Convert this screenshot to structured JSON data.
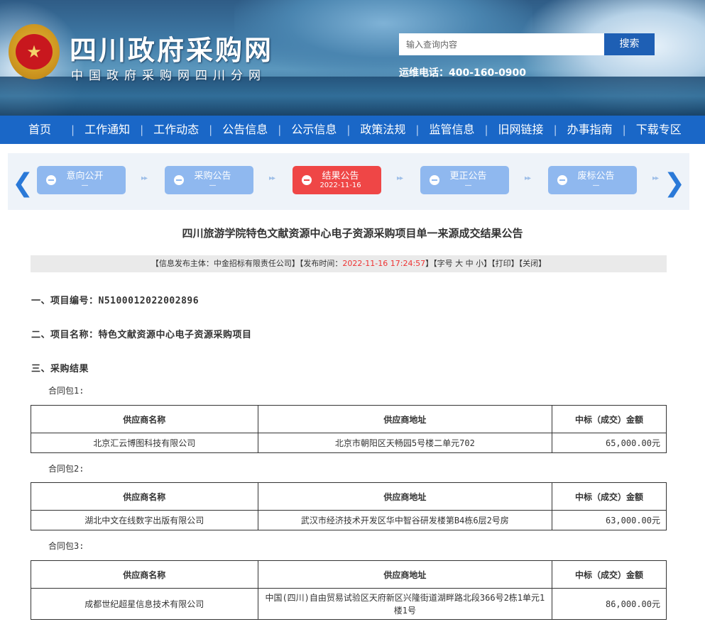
{
  "header": {
    "site_title": "四川政府采购网",
    "site_subtitle": "中国政府采购网四川分网",
    "search_placeholder": "输入查询内容",
    "search_button": "搜索",
    "hotline": "运维电话：400-160-0900"
  },
  "nav": {
    "items": [
      "首页",
      "工作通知",
      "工作动态",
      "公告信息",
      "公示信息",
      "政策法规",
      "监管信息",
      "旧网链接",
      "办事指南",
      "下载专区"
    ],
    "separator": "|"
  },
  "process": {
    "steps": [
      {
        "name": "意向公开",
        "date": "—",
        "active": false
      },
      {
        "name": "采购公告",
        "date": "—",
        "active": false
      },
      {
        "name": "结果公告",
        "date": "2022-11-16",
        "active": true
      },
      {
        "name": "更正公告",
        "date": "—",
        "active": false
      },
      {
        "name": "废标公告",
        "date": "—",
        "active": false
      }
    ],
    "connector": "▸▸",
    "prev_arrow": "❮",
    "next_arrow": "❯"
  },
  "article": {
    "title": "四川旅游学院特色文献资源中心电子资源采购项目单一来源成交结果公告",
    "meta": {
      "publisher_prefix": "【信息发布主体：中金招标有限责任公司】【发布时间：",
      "publish_time": "2022-11-16 17:24:57",
      "font_size_part": "】【字号 大 中 小】",
      "print": "【打印】",
      "close": "【关闭】"
    },
    "section1": "一、项目编号：N5100012022002896",
    "section2": "二、项目名称：特色文献资源中心电子资源采购项目",
    "section3": "三、采购结果",
    "table_headers": [
      "供应商名称",
      "供应商地址",
      "中标（成交）金额"
    ],
    "packages": [
      {
        "label": "合同包1:",
        "rows": [
          [
            "北京汇云博图科技有限公司",
            "北京市朝阳区天畅园5号楼二单元702",
            "65,000.00元"
          ]
        ]
      },
      {
        "label": "合同包2:",
        "rows": [
          [
            "湖北中文在线数字出版有限公司",
            "武汉市经济技术开发区华中智谷研发楼第B4栋6层2号房",
            "63,000.00元"
          ]
        ]
      },
      {
        "label": "合同包3:",
        "rows": [
          [
            "成都世纪超星信息技术有限公司",
            "中国(四川)自由贸易试验区天府新区兴隆街道湖畔路北段366号2栋1单元1楼1号",
            "86,000.00元"
          ]
        ]
      }
    ]
  }
}
